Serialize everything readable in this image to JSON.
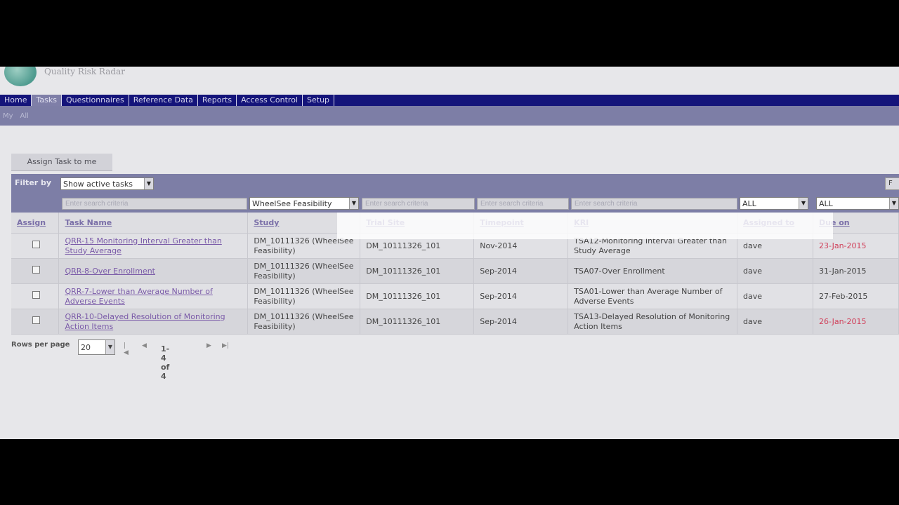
{
  "app": {
    "title": "Quality Risk Radar"
  },
  "nav": {
    "items": [
      {
        "label": "Home"
      },
      {
        "label": "Tasks"
      },
      {
        "label": "Questionnaires"
      },
      {
        "label": "Reference Data"
      },
      {
        "label": "Reports"
      },
      {
        "label": "Access Control"
      },
      {
        "label": "Setup"
      }
    ],
    "active": "Tasks"
  },
  "subnav": {
    "items": [
      {
        "label": "My"
      },
      {
        "label": "All"
      }
    ]
  },
  "toolbar": {
    "assign_label": "Assign Task to me"
  },
  "filter": {
    "label": "Filter by",
    "selected": "Show active tasks",
    "study_selected": "WheelSee Feasibility",
    "assigned_selected": "ALL",
    "due_selected": "ALL",
    "search_placeholder": "Enter search criteria",
    "trial_site_placeholder": "Enter search criteria",
    "timepoint_placeholder": "Enter search criteria",
    "kri_placeholder": "Enter search criteria"
  },
  "table": {
    "columns": [
      "Assign",
      "Task Name",
      "Study",
      "Trial Site",
      "Timepoint",
      "KRI",
      "Assigned to",
      "Due on"
    ],
    "rows": [
      {
        "task_name": "QRR-15 Monitoring Interval Greater than Study Average",
        "study": "DM_10111326 (WheelSee Feasibility)",
        "trial_site": "DM_10111326_101",
        "timepoint": "Nov-2014",
        "kri": "TSA12-Monitoring Interval Greater than Study Average",
        "assigned_to": "dave",
        "due_on": "23-Jan-2015",
        "overdue": true
      },
      {
        "task_name": "QRR-8-Over Enrollment",
        "study": "DM_10111326 (WheelSee Feasibility)",
        "trial_site": "DM_10111326_101",
        "timepoint": "Sep-2014",
        "kri": "TSA07-Over Enrollment",
        "assigned_to": "dave",
        "due_on": "31-Jan-2015",
        "overdue": false
      },
      {
        "task_name": "QRR-7-Lower than Average Number of Adverse Events",
        "study": "DM_10111326 (WheelSee Feasibility)",
        "trial_site": "DM_10111326_101",
        "timepoint": "Sep-2014",
        "kri": "TSA01-Lower than Average Number of Adverse Events",
        "assigned_to": "dave",
        "due_on": "27-Feb-2015",
        "overdue": false
      },
      {
        "task_name": "QRR-10-Delayed Resolution of Monitoring Action Items",
        "study": "DM_10111326 (WheelSee Feasibility)",
        "trial_site": "DM_10111326_101",
        "timepoint": "Sep-2014",
        "kri": "TSA13-Delayed Resolution of Monitoring Action Items",
        "assigned_to": "dave",
        "due_on": "26-Jan-2015",
        "overdue": true
      }
    ]
  },
  "pager": {
    "rows_label": "Rows per page",
    "rows_value": "20",
    "first": "|◀",
    "prev": "◀",
    "info": "1-4 of 4",
    "next": "▶",
    "last": "▶|"
  },
  "colors": {
    "nav_bg": "#14147a",
    "filter_bg": "#7d7ea6",
    "overdue": "#d0405a",
    "link": "#7a5aa8"
  }
}
